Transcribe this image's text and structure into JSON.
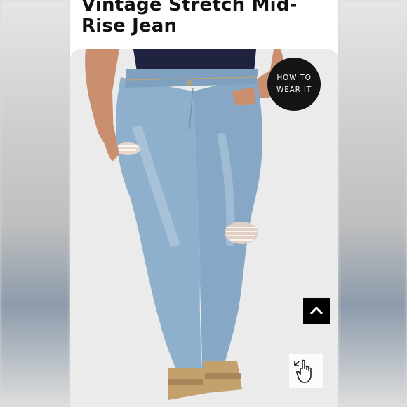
{
  "product": {
    "title_line1": "Vintage Stretch Mid-",
    "title_line2": "Rise Jean"
  },
  "how_to_wear": {
    "line1": "HOW TO",
    "line2": "WEAR IT"
  },
  "icons": {
    "scroll_top": "chevron-up-icon",
    "zoom": "pinch-zoom-hand-icon"
  },
  "colors": {
    "denim": "#8fb0cc",
    "top": "#1f2340",
    "skin": "#c98f6e",
    "button_dark": "#141414"
  }
}
